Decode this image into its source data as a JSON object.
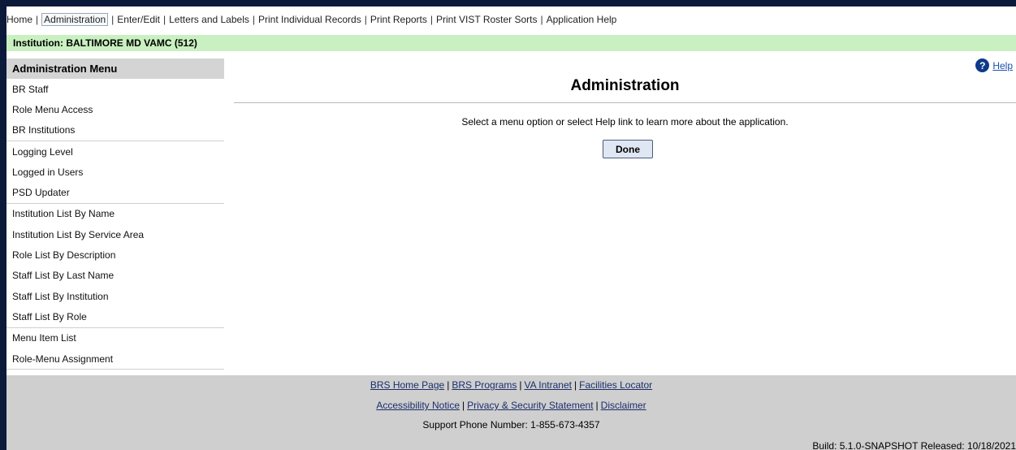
{
  "topnav": {
    "items": [
      "Home",
      "Administration",
      "Enter/Edit",
      "Letters and Labels",
      "Print Individual Records",
      "Print Reports",
      "Print VIST Roster Sorts",
      "Application Help"
    ],
    "active": "Administration"
  },
  "institution": "Institution: BALTIMORE MD VAMC (512)",
  "sidebar": {
    "title": "Administration Menu",
    "groups": [
      [
        "BR Staff",
        "Role Menu Access",
        "BR Institutions"
      ],
      [
        "Logging Level",
        "Logged in Users",
        "PSD Updater"
      ],
      [
        "Institution List By Name",
        "Institution List By Service Area",
        "Role List By Description",
        "Staff List By Last Name",
        "Staff List By Institution",
        "Staff List By Role"
      ],
      [
        "Menu Item List",
        "Role-Menu Assignment"
      ]
    ]
  },
  "help": {
    "icon": "question-icon",
    "label": "Help"
  },
  "main": {
    "title": "Administration",
    "message": "Select a menu option or select Help link to learn more about the application.",
    "done_label": "Done"
  },
  "footer": {
    "row1": [
      "BRS Home Page",
      "BRS Programs",
      "VA Intranet",
      "Facilities Locator"
    ],
    "row2": [
      "Accessibility Notice",
      "Privacy & Security Statement",
      "Disclaimer"
    ],
    "support": "Support Phone Number: 1-855-673-4357",
    "build": "Build: 5.1.0-SNAPSHOT Released: 10/18/2021"
  },
  "colors": {
    "frame": "#0b1a3a",
    "institution_bar": "#c9f0c0",
    "sidebar_header": "#d4d4d4",
    "footer_bg": "#cfcfcf",
    "link": "#1a4fb0"
  }
}
